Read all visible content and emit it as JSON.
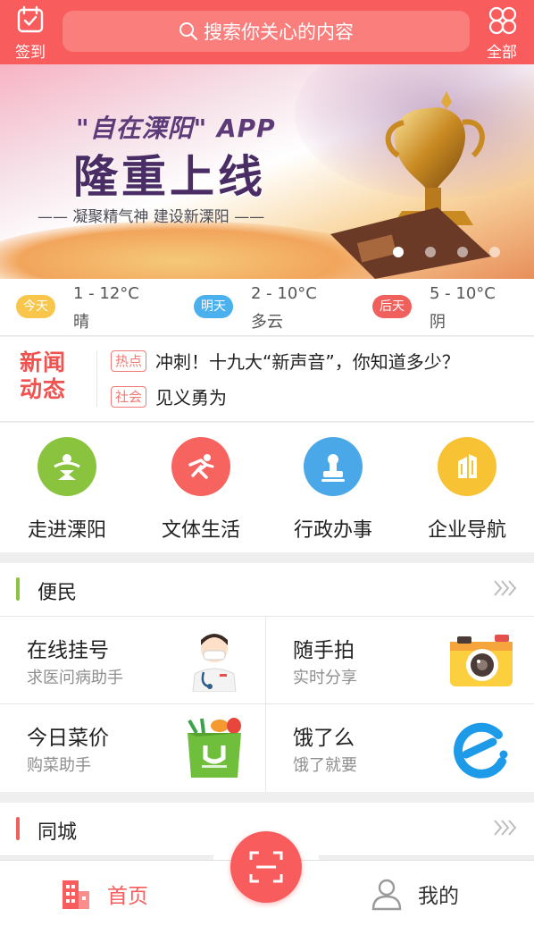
{
  "header": {
    "checkin_label": "签到",
    "all_label": "全部",
    "search_placeholder": "搜索你关心的内容"
  },
  "banner": {
    "app_line": "\"自在溧阳\" APP",
    "title": "隆重上线",
    "slogan": "——  凝聚精气神   建设新溧阳  ——",
    "page_count": 4,
    "active_page": 1
  },
  "weather": [
    {
      "day": "今天",
      "temp": "1 - 12°C",
      "cond": "晴",
      "color": "#f7c64b"
    },
    {
      "day": "明天",
      "temp": "2 - 10°C",
      "cond": "多云",
      "color": "#4ab0ee"
    },
    {
      "day": "后天",
      "temp": "5 - 10°C",
      "cond": "阴",
      "color": "#f0605c"
    }
  ],
  "news": {
    "logo_line1": "新闻",
    "logo_line2": "动态",
    "items": [
      {
        "tag": "热点",
        "text": "冲刺！十九大“新声音”，你知道多少？"
      },
      {
        "tag": "社会",
        "text": "见义勇为"
      }
    ]
  },
  "quick_nav": [
    {
      "label": "走进溧阳",
      "icon": "landscape-icon",
      "color": "#8ac43f"
    },
    {
      "label": "文体生活",
      "icon": "runner-icon",
      "color": "#f7645f"
    },
    {
      "label": "行政办事",
      "icon": "stamp-icon",
      "color": "#4aa8e8"
    },
    {
      "label": "企业导航",
      "icon": "building-icon",
      "color": "#f7c233"
    }
  ],
  "convenience": {
    "title": "便民",
    "accent": "#8ac43f",
    "items": [
      {
        "title": "在线挂号",
        "subtitle": "求医问病助手",
        "icon": "doctor-icon"
      },
      {
        "title": "随手拍",
        "subtitle": "实时分享",
        "icon": "camera-icon"
      },
      {
        "title": "今日菜价",
        "subtitle": "购菜助手",
        "icon": "grocery-bag-icon"
      },
      {
        "title": "饿了么",
        "subtitle": "饿了就要",
        "icon": "eleme-icon"
      }
    ]
  },
  "city": {
    "title": "同城",
    "accent": "#f0605c"
  },
  "tabbar": {
    "home_label": "首页",
    "mine_label": "我的",
    "accent": "#f85c5c"
  }
}
